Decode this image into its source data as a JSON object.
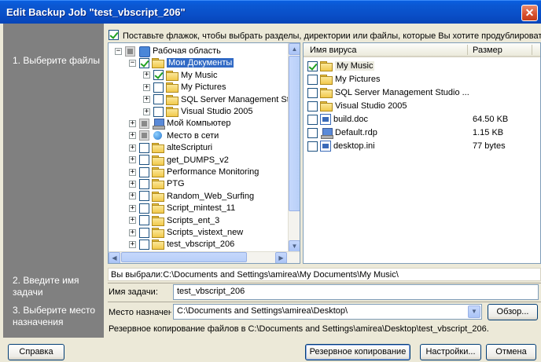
{
  "window": {
    "title": "Edit Backup Job \"test_vbscript_206\"",
    "close_symbol": "✕"
  },
  "steps": {
    "step1": "1. Выберите файлы",
    "step2": "2. Введите имя задачи",
    "step3": "3. Выберите место назначения"
  },
  "instruction": "Поставьте флажок, чтобы выбрать разделы, директории или файлы, которые Вы хотите продублировать",
  "tree": {
    "items": [
      {
        "label": "Рабочая область",
        "expander": "−",
        "check": "gray",
        "icon": "workspace-icon"
      },
      {
        "label": "Мои Документы",
        "expander": "−",
        "check": "checked",
        "icon": "my-documents-icon",
        "selected": true
      },
      {
        "label": "My Music",
        "expander": "+",
        "check": "checked",
        "icon": "folder-icon"
      },
      {
        "label": "My Pictures",
        "expander": "+",
        "check": "none",
        "icon": "folder-icon"
      },
      {
        "label": "SQL Server Management Stu",
        "expander": "+",
        "check": "none",
        "icon": "folder-icon"
      },
      {
        "label": "Visual Studio 2005",
        "expander": "+",
        "check": "none",
        "icon": "folder-icon"
      },
      {
        "label": "Мой Компьютер",
        "expander": "+",
        "check": "gray",
        "icon": "computer-icon"
      },
      {
        "label": "Место в сети",
        "expander": "+",
        "check": "gray",
        "icon": "network-icon"
      },
      {
        "label": "alteScripturi",
        "expander": "+",
        "check": "none",
        "icon": "folder-icon"
      },
      {
        "label": "get_DUMPS_v2",
        "expander": "+",
        "check": "none",
        "icon": "folder-icon"
      },
      {
        "label": "Performance Monitoring",
        "expander": "+",
        "check": "none",
        "icon": "folder-icon"
      },
      {
        "label": "PTG",
        "expander": "+",
        "check": "none",
        "icon": "folder-icon"
      },
      {
        "label": "Random_Web_Surfing",
        "expander": "+",
        "check": "none",
        "icon": "folder-icon"
      },
      {
        "label": "Script_mintest_11",
        "expander": "+",
        "check": "none",
        "icon": "folder-icon"
      },
      {
        "label": "Scripts_ent_3",
        "expander": "+",
        "check": "none",
        "icon": "folder-icon"
      },
      {
        "label": "Scripts_vistext_new",
        "expander": "+",
        "check": "none",
        "icon": "folder-icon"
      },
      {
        "label": "test_vbscript_206",
        "expander": "+",
        "check": "none",
        "icon": "folder-icon"
      }
    ]
  },
  "list": {
    "col_name": "Имя вируса",
    "col_size": "Размер",
    "rows": [
      {
        "name": "My Music",
        "size": "",
        "check": "checked",
        "icon": "folder-icon",
        "selected": true
      },
      {
        "name": "My Pictures",
        "size": "",
        "check": "none",
        "icon": "folder-icon"
      },
      {
        "name": "SQL Server Management Studio ...",
        "size": "",
        "check": "none",
        "icon": "folder-icon"
      },
      {
        "name": "Visual Studio 2005",
        "size": "",
        "check": "none",
        "icon": "folder-icon"
      },
      {
        "name": "build.doc",
        "size": "64.50 KB",
        "check": "none",
        "icon": "word-doc-icon"
      },
      {
        "name": "Default.rdp",
        "size": "1.15 KB",
        "check": "none",
        "icon": "rdp-file-icon"
      },
      {
        "name": "desktop.ini",
        "size": "77 bytes",
        "check": "none",
        "icon": "ini-file-icon"
      }
    ]
  },
  "selection_path": "Вы выбрали:C:\\Documents and Settings\\amirea\\My Documents\\My Music\\",
  "task": {
    "label": "Имя задачи:",
    "value": "test_vbscript_206"
  },
  "destination": {
    "label": "Место назначения:",
    "value": "C:\\Documents and Settings\\amirea\\Desktop\\",
    "browse": "Обзор...",
    "summary": "Резервное копирование файлов в C:\\Documents and Settings\\amirea\\Desktop\\test_vbscript_206."
  },
  "buttons": {
    "help": "Справка",
    "backup": "Резервное копирование",
    "settings": "Настройки...",
    "cancel": "Отмена"
  }
}
